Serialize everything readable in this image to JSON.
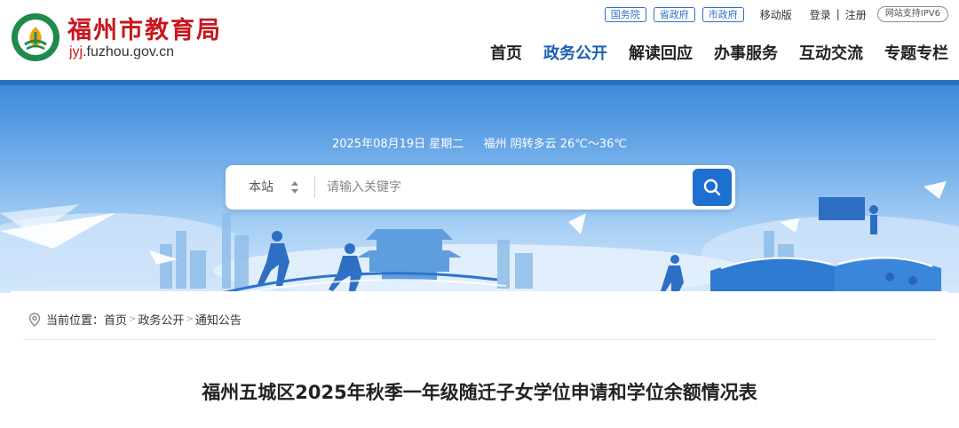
{
  "header": {
    "site_name": "福州市教育局",
    "domain_prefix": "jyj",
    "domain_suffix": ".fuzhou.gov.cn",
    "emblem_text": "FUZHOU EDUCATION",
    "brand_color": "#c8161d",
    "accent_color": "#1a5fb4"
  },
  "top_links": {
    "gov_links": [
      "国务院",
      "省政府",
      "市政府"
    ],
    "mobile": "移动版",
    "login": "登录",
    "separator": "|",
    "register": "注册",
    "ipv6": "网站支持IPV6"
  },
  "nav": {
    "items": [
      "首页",
      "政务公开",
      "解读回应",
      "办事服务",
      "互动交流",
      "专题专栏"
    ],
    "active_index": 1
  },
  "banner": {
    "date": "2025年08月19日 星期二",
    "weather": "福州 阴转多云 26℃～36℃"
  },
  "search": {
    "scope": "本站",
    "placeholder": "请输入关键字",
    "button_icon": "search-icon"
  },
  "breadcrumb": {
    "prefix": "当前位置：",
    "items": [
      "首页",
      "政务公开",
      "通知公告"
    ],
    "separator": ">",
    "icon": "location-pin-icon"
  },
  "article": {
    "title": "福州五城区2025年秋季一年级随迁子女学位申请和学位余额情况表"
  }
}
